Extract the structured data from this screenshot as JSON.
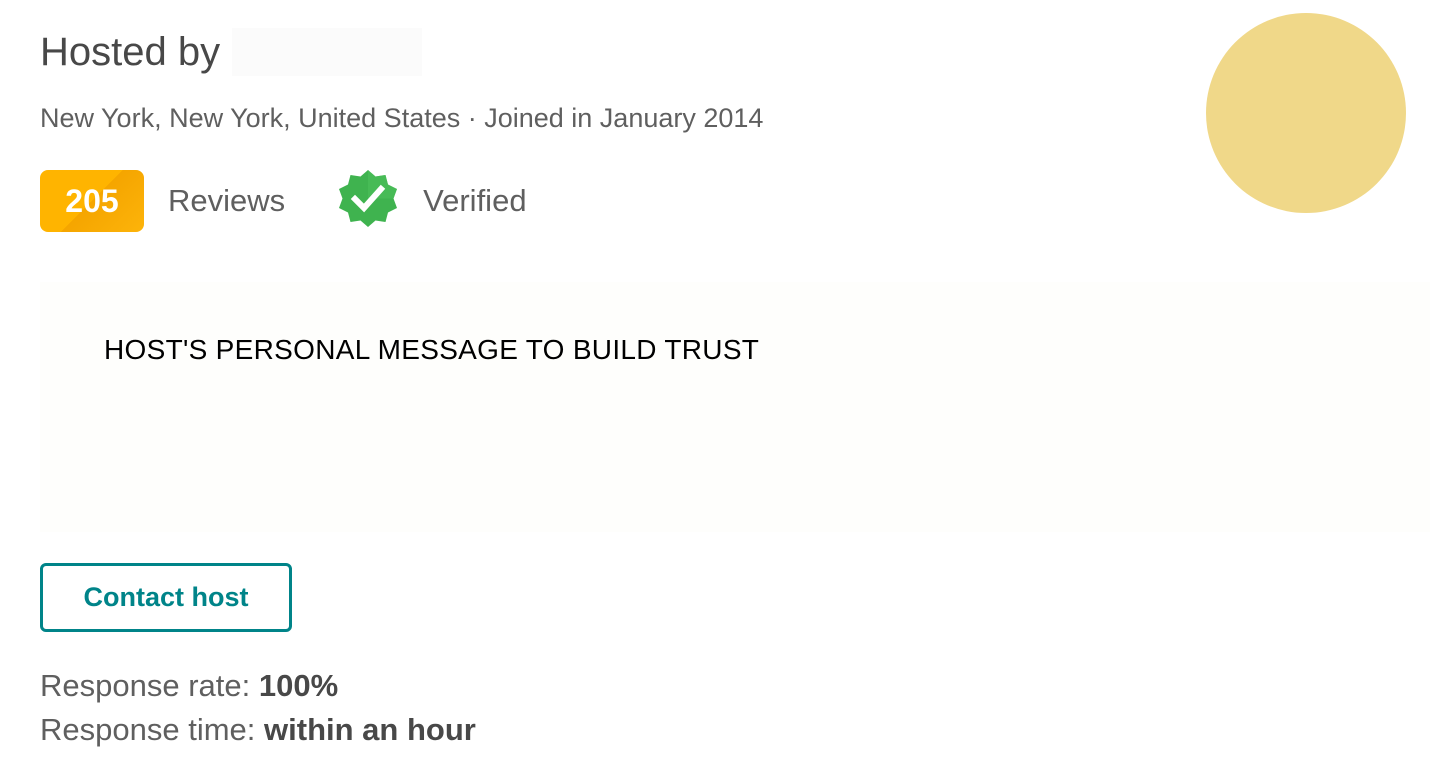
{
  "host": {
    "title_prefix": "Hosted by",
    "location_line": "New York, New York, United States · Joined in January 2014",
    "avatar_color": "#f0d889"
  },
  "stats": {
    "reviews_count": "205",
    "reviews_label": "Reviews",
    "verified_label": "Verified",
    "verified_icon": "verified-badge-icon",
    "badge_color": "#ffb400",
    "verified_color": "#3fb34f"
  },
  "message": {
    "text": "HOST'S PERSONAL MESSAGE TO BUILD TRUST"
  },
  "contact": {
    "button_label": "Contact host",
    "accent_color": "#008489"
  },
  "response": {
    "rate_label": "Response rate:",
    "rate_value": "100%",
    "time_label": "Response time:",
    "time_value": "within an hour"
  }
}
